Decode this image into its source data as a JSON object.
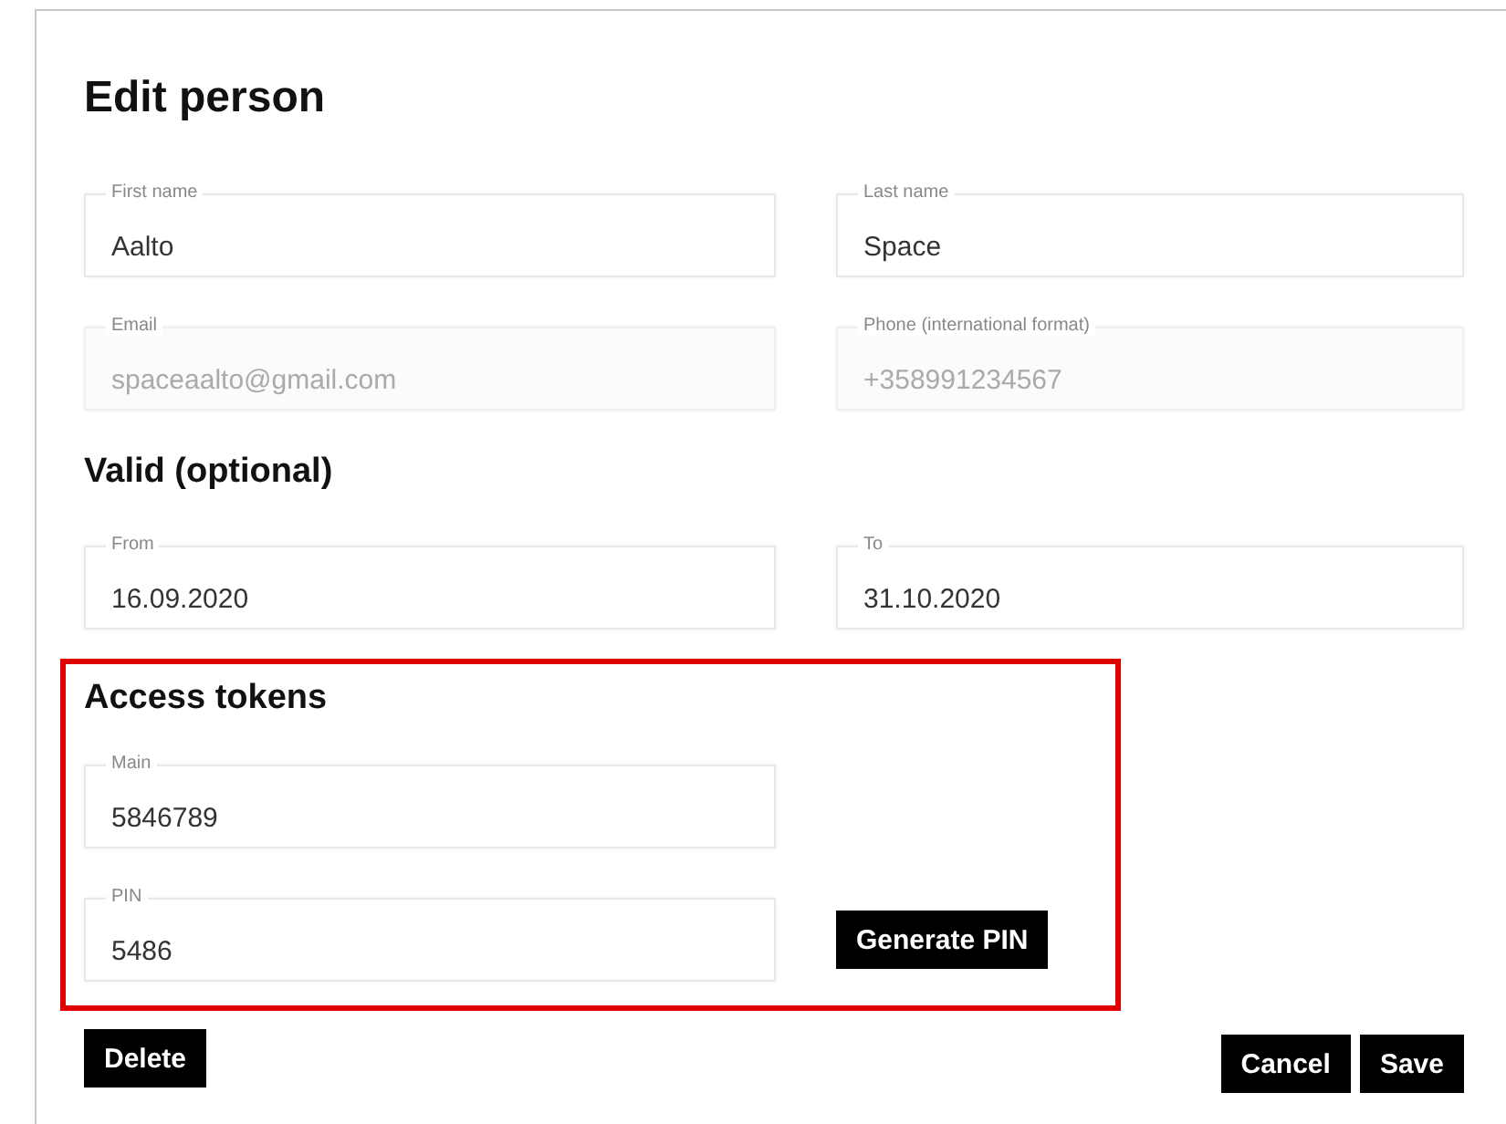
{
  "title": "Edit person",
  "person_fields": [
    {
      "label": "First name",
      "value": "Aalto",
      "disabled": false
    },
    {
      "label": "Last name",
      "value": "Space",
      "disabled": false
    },
    {
      "label": "Email",
      "value": "spaceaalto@gmail.com",
      "disabled": true
    },
    {
      "label": "Phone (international format)",
      "value": "+358991234567",
      "disabled": true
    }
  ],
  "valid": {
    "heading": "Valid (optional)",
    "fields": [
      {
        "label": "From",
        "value": "16.09.2020",
        "disabled": false
      },
      {
        "label": "To",
        "value": "31.10.2020",
        "disabled": false
      }
    ]
  },
  "access_tokens": {
    "heading": "Access tokens",
    "highlighted": true,
    "fields": [
      {
        "label": "Main",
        "value": "5846789",
        "disabled": false
      },
      {
        "label": "PIN",
        "value": "5486",
        "disabled": false
      }
    ],
    "generate_button": "Generate PIN"
  },
  "buttons": {
    "delete": "Delete",
    "cancel": "Cancel",
    "save": "Save"
  }
}
